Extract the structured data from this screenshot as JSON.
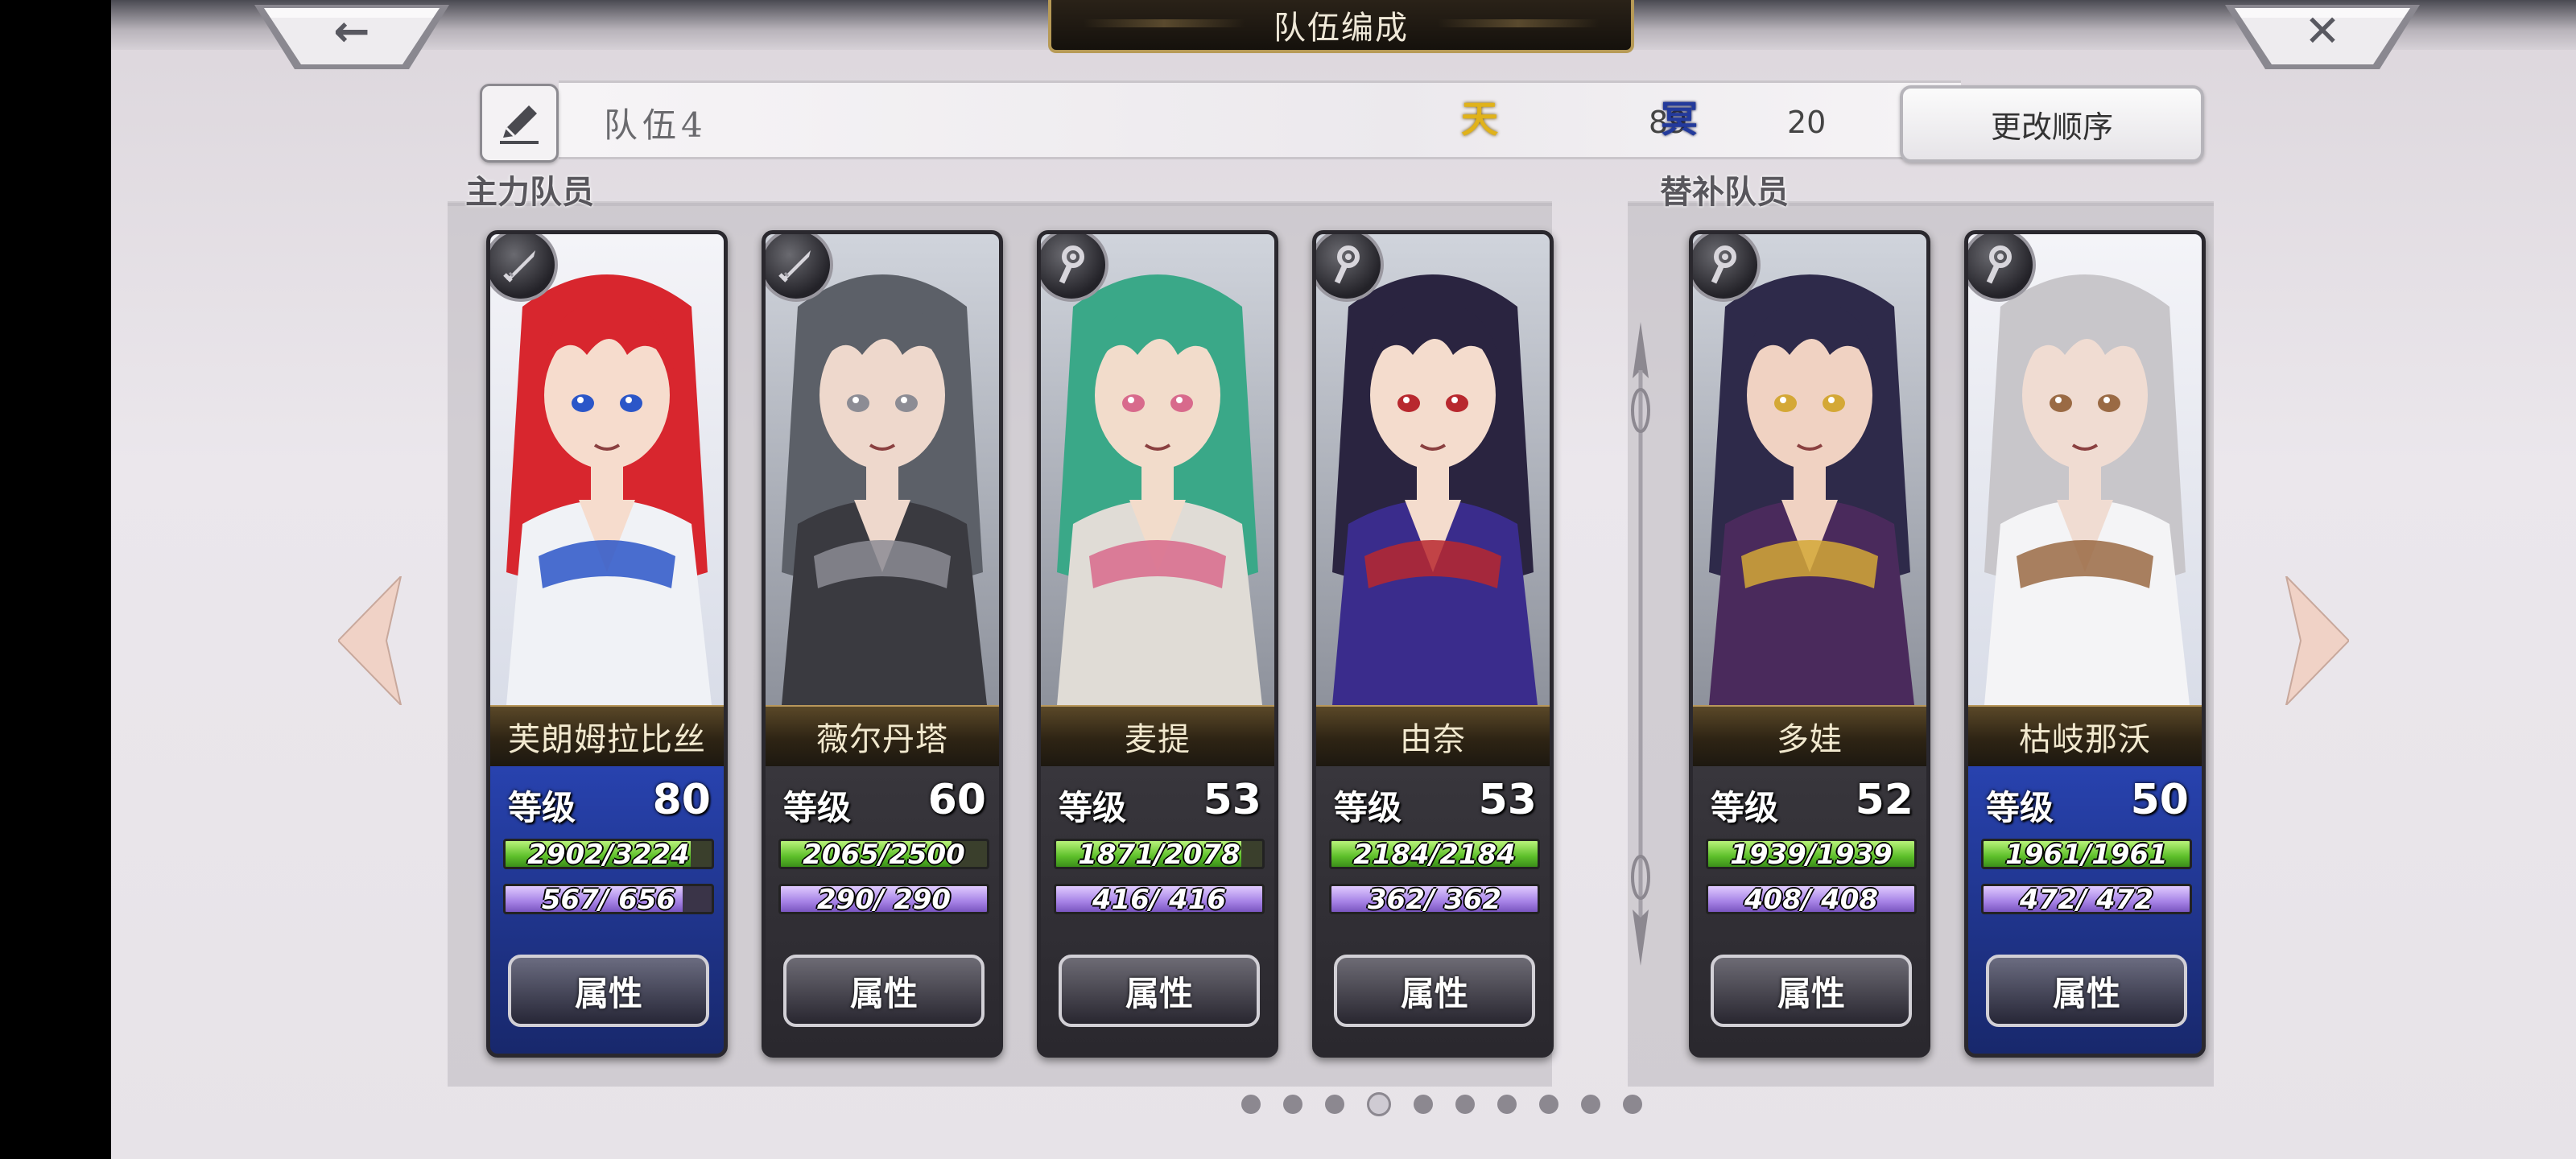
{
  "header": {
    "title": "队伍编成",
    "back_icon": "←",
    "close_icon": "✕"
  },
  "team": {
    "name": "队伍4",
    "sun_label": "天",
    "moon_label": "冥",
    "sun_value": "89",
    "moon_value": "20",
    "change_order_label": "更改顺序"
  },
  "sections": {
    "main_label": "主力队员",
    "sub_label": "替补队员"
  },
  "colors": {
    "hp": "#5dbf2a",
    "mp": "#a682e6",
    "sun": "#e0b21a",
    "moon": "#233a9c"
  },
  "main_members": [
    {
      "name": "芙朗姆拉比丝",
      "level_label": "等级",
      "level": "80",
      "hp": "2902/3224",
      "hp_ratio": 0.9,
      "mp": "567/ 656",
      "mp_ratio": 0.86,
      "button": "属性",
      "weapon_icon": "sword-icon",
      "bg": "blue",
      "hair": "#d8262e",
      "skin": "#f6dccd",
      "cloth": "#f0f2f6",
      "accent": "#2b56c8"
    },
    {
      "name": "薇尔丹塔",
      "level_label": "等级",
      "level": "60",
      "hp": "2065/2500",
      "hp_ratio": 0.83,
      "mp": "290/ 290",
      "mp_ratio": 1.0,
      "button": "属性",
      "weapon_icon": "sword-icon",
      "bg": "gray",
      "hair": "#5c6068",
      "skin": "#eed8cc",
      "cloth": "#3a3a40",
      "accent": "#8c8c94"
    },
    {
      "name": "麦提",
      "level_label": "等级",
      "level": "53",
      "hp": "1871/2078",
      "hp_ratio": 0.9,
      "mp": "416/ 416",
      "mp_ratio": 1.0,
      "button": "属性",
      "weapon_icon": "staff-icon",
      "bg": "gray",
      "hair": "#3aa888",
      "skin": "#f2dccb",
      "cloth": "#e0dcd6",
      "accent": "#d86a8c"
    },
    {
      "name": "由奈",
      "level_label": "等级",
      "level": "53",
      "hp": "2184/2184",
      "hp_ratio": 1.0,
      "mp": "362/ 362",
      "mp_ratio": 1.0,
      "button": "属性",
      "weapon_icon": "staff-icon",
      "bg": "gray",
      "hair": "#2a2440",
      "skin": "#f4dccd",
      "cloth": "#3a2c8c",
      "accent": "#b8282e"
    }
  ],
  "sub_members": [
    {
      "name": "多娃",
      "level_label": "等级",
      "level": "52",
      "hp": "1939/1939",
      "hp_ratio": 1.0,
      "mp": "408/ 408",
      "mp_ratio": 1.0,
      "button": "属性",
      "weapon_icon": "staff-icon",
      "bg": "gray",
      "hair": "#2e2a4a",
      "skin": "#f0d2c2",
      "cloth": "#4a2a5c",
      "accent": "#d4a836"
    },
    {
      "name": "枯岐那沃",
      "level_label": "等级",
      "level": "50",
      "hp": "1961/1961",
      "hp_ratio": 1.0,
      "mp": "472/ 472",
      "mp_ratio": 1.0,
      "button": "属性",
      "weapon_icon": "staff-icon",
      "bg": "blue",
      "hair": "#c8c6ca",
      "skin": "#f0dcd2",
      "cloth": "#f4f4f6",
      "accent": "#9a6a44"
    }
  ],
  "pager": {
    "count": 10,
    "active_index": 3
  }
}
